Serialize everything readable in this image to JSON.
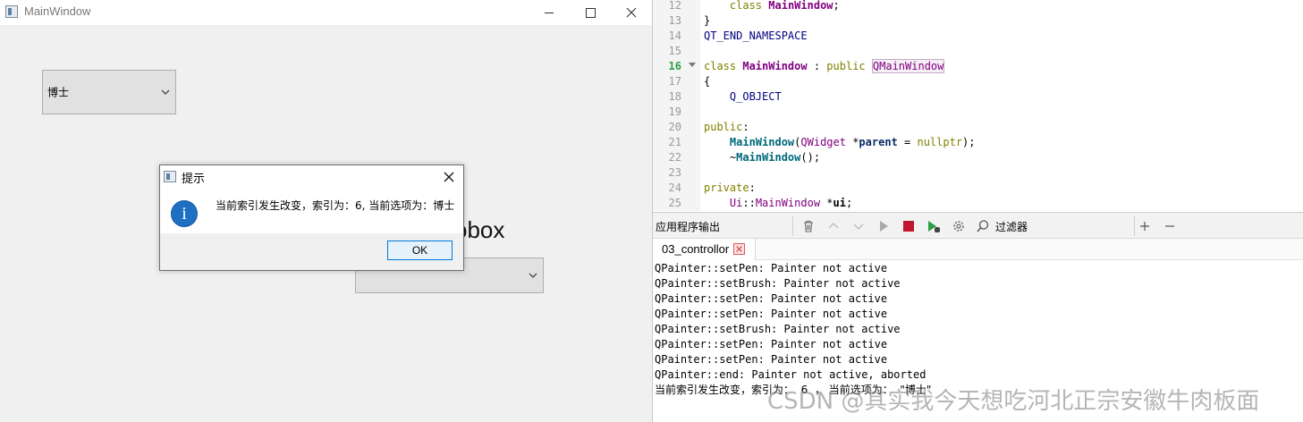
{
  "main_window": {
    "title": "MainWindow",
    "combo1_value": "博士",
    "behind_label_fragment": "obox",
    "combo2_value": ""
  },
  "message_box": {
    "title": "提示",
    "text": "当前索引发生改变，索引为：6, 当前选项为：博士",
    "ok_label": "OK"
  },
  "editor": {
    "lines": [
      {
        "num": "12",
        "html": "    <span class=\"kw\">class</span> <span class=\"cls\">MainWindow</span>;"
      },
      {
        "num": "13",
        "html": "}"
      },
      {
        "num": "14",
        "html": "<span class=\"mac\">QT_END_NAMESPACE</span>"
      },
      {
        "num": "15",
        "html": ""
      },
      {
        "num": "16",
        "html": "<span class=\"kw\">class</span> <span class=\"cls\">MainWindow</span> : <span class=\"kw\">public</span> <span class=\"typ hl-box\">QMainWindow</span>"
      },
      {
        "num": "17",
        "html": "{"
      },
      {
        "num": "18",
        "html": "    <span class=\"mac\">Q_OBJECT</span>"
      },
      {
        "num": "19",
        "html": ""
      },
      {
        "num": "20",
        "html": "<span class=\"kw\">public</span>:"
      },
      {
        "num": "21",
        "html": "    <span class=\"fn\">MainWindow</span>(<span class=\"typ\">QWidget</span> *<span class=\"ptr\"><b>parent</b></span> = <span class=\"kw\">nullptr</span>);"
      },
      {
        "num": "22",
        "html": "    ~<span class=\"fn\">MainWindow</span>();"
      },
      {
        "num": "23",
        "html": ""
      },
      {
        "num": "24",
        "html": "<span class=\"kw\">private</span>:"
      },
      {
        "num": "25",
        "html": "    <span class=\"typ\">Ui</span>::<span class=\"typ\">MainWindow</span> *<b>ui</b>;"
      }
    ],
    "current_line": "16"
  },
  "output_pane": {
    "title": "应用程序输出",
    "filter_placeholder": "过滤器",
    "tab_label": "03_controllor",
    "lines": [
      "QPainter::setPen: Painter not active",
      "QPainter::setBrush: Painter not active",
      "QPainter::setPen: Painter not active",
      "QPainter::setPen: Painter not active",
      "QPainter::setBrush: Painter not active",
      "QPainter::setPen: Painter not active",
      "QPainter::setPen: Painter not active",
      "QPainter::end: Painter not active, aborted",
      "当前索引发生改变，索引为：  6  ， 当前选项为：  \"博士\""
    ]
  },
  "watermark": "CSDN @其实我今天想吃河北正宗安徽牛肉板面"
}
